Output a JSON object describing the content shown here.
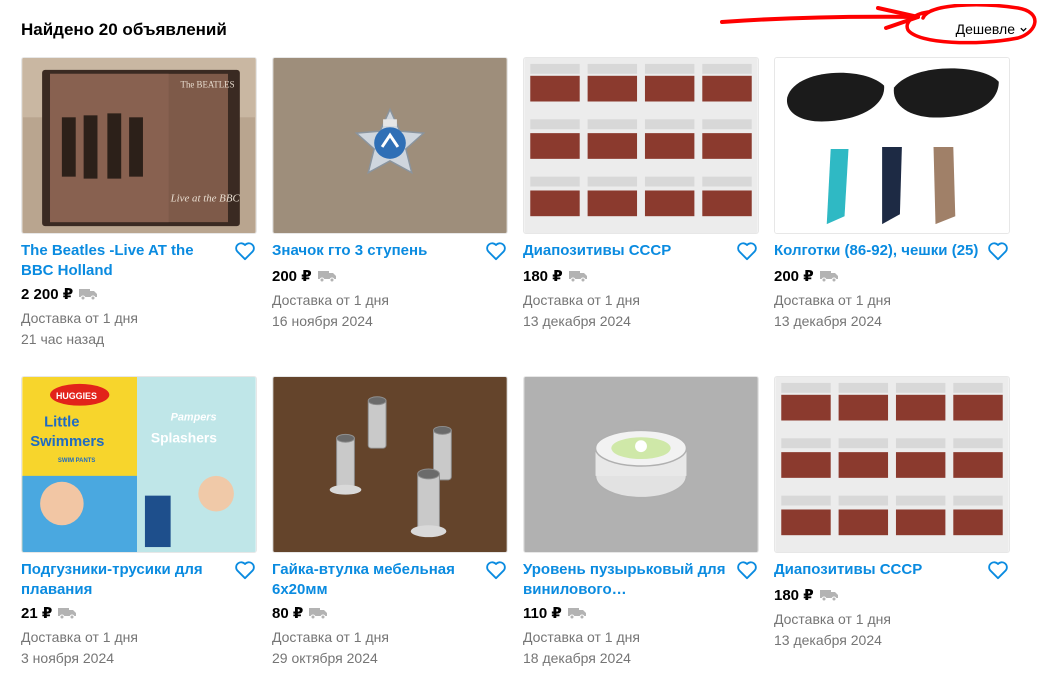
{
  "header": {
    "results_title": "Найдено 20 объявлений",
    "sort_label": "Дешевле"
  },
  "annotation": {
    "color": "#ff0000"
  },
  "colors": {
    "link": "#0a8be0",
    "meta": "#757575",
    "price": "#000000"
  },
  "listings": [
    {
      "title": "The Beatles -Live AT the BBC Holland",
      "price": "2 200 ₽",
      "delivery": "Доставка от 1 дня",
      "date": "21 час назад",
      "image": "cd-box-the-beatles"
    },
    {
      "title": "Значок гто 3 ступень",
      "price": "200 ₽",
      "delivery": "Доставка от 1 дня",
      "date": "16 ноября 2024",
      "image": "gto-badge"
    },
    {
      "title": "Диапозитивы СССР",
      "price": "180 ₽",
      "delivery": "Доставка от 1 дня",
      "date": "13 декабря 2024",
      "image": "slide-boxes"
    },
    {
      "title": "Колготки (86-92), чешки (25)",
      "price": "200 ₽",
      "delivery": "Доставка от 1 дня",
      "date": "13 декабря 2024",
      "image": "tights-and-shoes"
    },
    {
      "title": "Подгузники-трусики для плавания",
      "price": "21 ₽",
      "delivery": "Доставка от 1 дня",
      "date": "3 ноября 2024",
      "image": "swim-diapers"
    },
    {
      "title": "Гайка-втулка мебельная 6х20мм",
      "price": "80 ₽",
      "delivery": "Доставка от 1 дня",
      "date": "29 октября 2024",
      "image": "furniture-nuts"
    },
    {
      "title": "Уровень пузырьковый для винилового…",
      "price": "110 ₽",
      "delivery": "Доставка от 1 дня",
      "date": "18 декабря 2024",
      "image": "bubble-level"
    },
    {
      "title": "Диапозитивы СССР",
      "price": "180 ₽",
      "delivery": "Доставка от 1 дня",
      "date": "13 декабря 2024",
      "image": "slide-boxes"
    }
  ],
  "image_text": {
    "beatles_brand": "The BEATLES",
    "beatles_cover": "Live at the BBC",
    "huggies_brand": "HUGGIES",
    "huggies_product_1": "Little",
    "huggies_product_2": "Swimmers",
    "huggies_sub": "SWIM PANTS",
    "pampers_brand": "Pampers",
    "pampers_product": "Splashers"
  }
}
